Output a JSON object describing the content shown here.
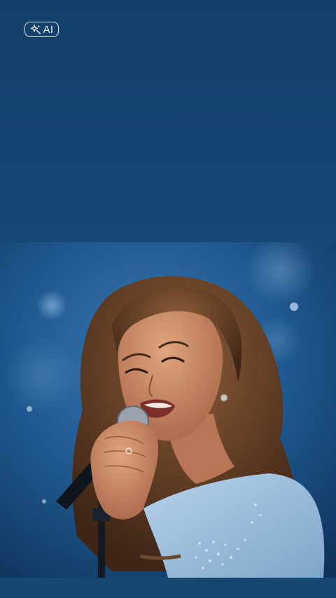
{
  "badge": {
    "icon": "sparkle-wand-icon",
    "label": "AI"
  },
  "photo": {
    "subject": "singer-with-microphone"
  },
  "colors": {
    "background": "#14436a",
    "badge_border": "#dbe6f2",
    "dress": "#9dc0de",
    "stage": "#1e5587"
  }
}
